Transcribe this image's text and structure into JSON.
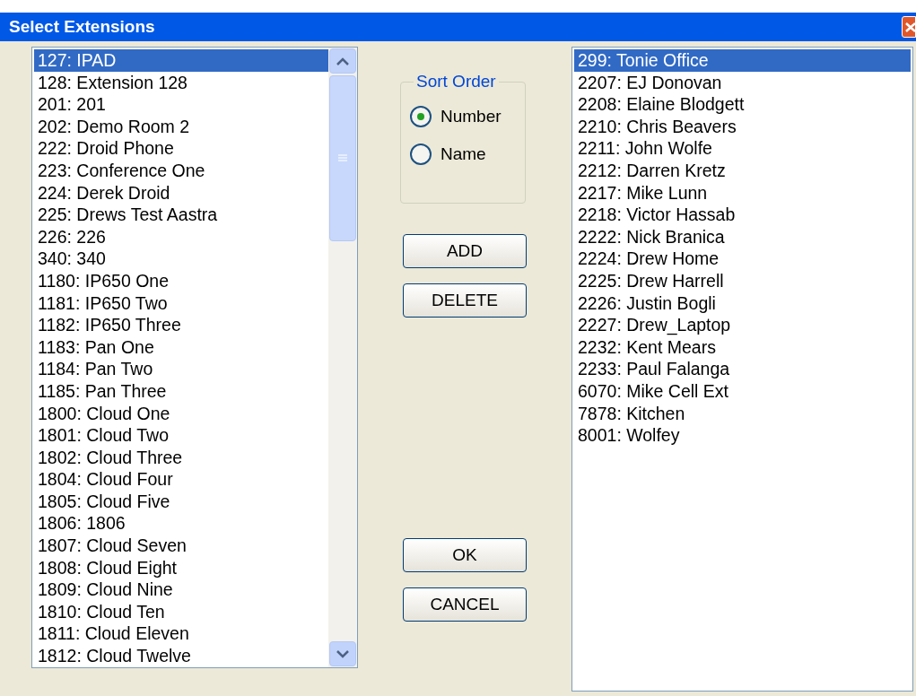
{
  "window": {
    "title": "Select Extensions"
  },
  "available": {
    "items": [
      {
        "label": "127: IPAD",
        "selected": true
      },
      {
        "label": "128: Extension 128",
        "selected": false
      },
      {
        "label": "201: 201",
        "selected": false
      },
      {
        "label": "202: Demo Room 2",
        "selected": false
      },
      {
        "label": "222: Droid Phone",
        "selected": false
      },
      {
        "label": "223: Conference One",
        "selected": false
      },
      {
        "label": "224: Derek Droid",
        "selected": false
      },
      {
        "label": "225: Drews Test Aastra",
        "selected": false
      },
      {
        "label": "226: 226",
        "selected": false
      },
      {
        "label": "340: 340",
        "selected": false
      },
      {
        "label": "1180: IP650 One",
        "selected": false
      },
      {
        "label": "1181: IP650 Two",
        "selected": false
      },
      {
        "label": "1182: IP650 Three",
        "selected": false
      },
      {
        "label": "1183: Pan One",
        "selected": false
      },
      {
        "label": "1184: Pan Two",
        "selected": false
      },
      {
        "label": "1185: Pan Three",
        "selected": false
      },
      {
        "label": "1800: Cloud One",
        "selected": false
      },
      {
        "label": "1801: Cloud Two",
        "selected": false
      },
      {
        "label": "1802: Cloud Three",
        "selected": false
      },
      {
        "label": "1804: Cloud Four",
        "selected": false
      },
      {
        "label": "1805: Cloud Five",
        "selected": false
      },
      {
        "label": "1806: 1806",
        "selected": false
      },
      {
        "label": "1807: Cloud Seven",
        "selected": false
      },
      {
        "label": "1808: Cloud Eight",
        "selected": false
      },
      {
        "label": "1809: Cloud Nine",
        "selected": false
      },
      {
        "label": "1810: Cloud Ten",
        "selected": false
      },
      {
        "label": "1811: Cloud Eleven",
        "selected": false
      },
      {
        "label": "1812: Cloud Twelve",
        "selected": false
      }
    ]
  },
  "sort_order": {
    "title": "Sort Order",
    "options": [
      {
        "label": "Number",
        "selected": true
      },
      {
        "label": "Name",
        "selected": false
      }
    ]
  },
  "buttons": [
    {
      "label": "ADD",
      "kind": "action"
    },
    {
      "label": "DELETE",
      "kind": "action"
    },
    {
      "label": "OK",
      "kind": "dialog"
    },
    {
      "label": "CANCEL",
      "kind": "dialog"
    }
  ],
  "chosen": {
    "items": [
      {
        "label": "299: Tonie Office",
        "selected": true
      },
      {
        "label": "2207: EJ Donovan",
        "selected": false
      },
      {
        "label": "2208: Elaine Blodgett",
        "selected": false
      },
      {
        "label": "2210: Chris Beavers",
        "selected": false
      },
      {
        "label": "2211: John Wolfe",
        "selected": false
      },
      {
        "label": "2212: Darren Kretz",
        "selected": false
      },
      {
        "label": "2217: Mike Lunn",
        "selected": false
      },
      {
        "label": "2218: Victor Hassab",
        "selected": false
      },
      {
        "label": "2222: Nick Branica",
        "selected": false
      },
      {
        "label": "2224: Drew Home",
        "selected": false
      },
      {
        "label": "2225: Drew Harrell",
        "selected": false
      },
      {
        "label": "2226: Justin Bogli",
        "selected": false
      },
      {
        "label": "2227: Drew_Laptop",
        "selected": false
      },
      {
        "label": "2232: Kent Mears",
        "selected": false
      },
      {
        "label": "2233: Paul Falanga",
        "selected": false
      },
      {
        "label": "6070: Mike Cell Ext",
        "selected": false
      },
      {
        "label": "7878: Kitchen",
        "selected": false
      },
      {
        "label": "8001: Wolfey",
        "selected": false
      }
    ]
  }
}
